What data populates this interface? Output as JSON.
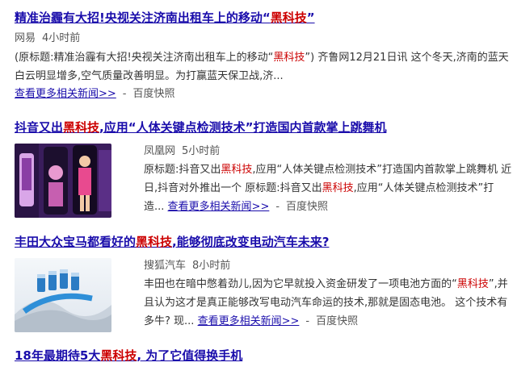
{
  "results": [
    {
      "title_pre": "精准治霾有大招!央视关注济南出租车上的移动“",
      "title_hl": "黑科技",
      "title_post": "”",
      "source": "网易",
      "time": "4小时前",
      "abstract_pre": "(原标题:精准治霾有大招!央视关注济南出租车上的移动“",
      "abstract_hl": "黑科技",
      "abstract_post": "”) 齐鲁网12月21日讯 这个冬天,济南的蓝天白云明显增多,空气质量改善明显。为打赢蓝天保卫战,济...",
      "more_link": "查看更多相关新闻>>",
      "separator": "-",
      "snapshot": "百度快照"
    },
    {
      "title_pre": "抖音又出",
      "title_hl": "黑科技",
      "title_post": ",应用“人体关键点检测技术”打造国内首款掌上跳舞机",
      "source": "凤凰网",
      "time": "5小时前",
      "abstract_pre": "原标题:抖音又出",
      "abstract_hl": "黑科技",
      "abstract_mid": ",应用“人体关键点检测技术”打造国内首款掌上跳舞机 近日,抖音对外推出一个 原标题:抖音又出",
      "abstract_hl2": "黑科技",
      "abstract_post": ",应用“人体关键点检测技术”打造...",
      "more_link": "查看更多相关新闻>>",
      "separator": "-",
      "snapshot": "百度快照"
    },
    {
      "title_pre": "丰田大众宝马都看好的",
      "title_hl": "黑科技",
      "title_post": ",能够彻底改变电动汽车未来?",
      "source": "搜狐汽车",
      "time": "8小时前",
      "abstract_pre": "丰田也在暗中憋着劲儿,因为它早就投入资金研发了一项电池方面的“",
      "abstract_hl": "黑科技",
      "abstract_post": "”,并且认为这才是真正能够改写电动汽车命运的技术,那就是固态电池。 这个技术有多牛? 现...",
      "more_link": "查看更多相关新闻>>",
      "separator": "-",
      "snapshot": "百度快照"
    },
    {
      "title_pre": "18年最期待5大",
      "title_hl": "黑科技",
      "title_post": ", 为了它值得换手机"
    }
  ]
}
